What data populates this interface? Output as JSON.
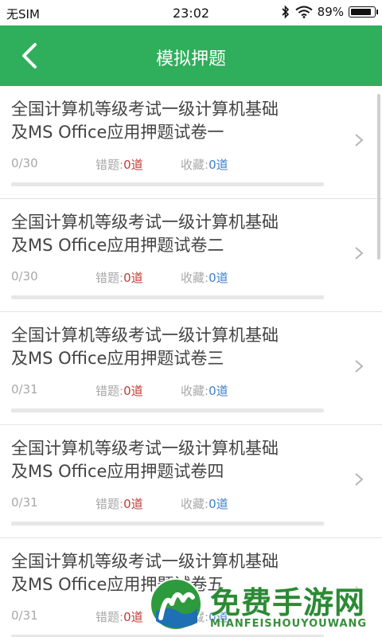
{
  "status_bar": {
    "carrier": "无SIM",
    "time": "23:02",
    "battery": "89%",
    "battery_level": 0.89
  },
  "nav": {
    "title": "模拟押题"
  },
  "labels": {
    "wrong": "错题:",
    "favorite": "收藏:"
  },
  "items": [
    {
      "title_line1": "全国计算机等级考试一级计算机基础",
      "title_line2": "及MS Office应用押题试卷一",
      "progress": "0/30",
      "wrong_count": "0道",
      "fav_count": "0道",
      "completion": 0
    },
    {
      "title_line1": "全国计算机等级考试一级计算机基础",
      "title_line2": "及MS Office应用押题试卷二",
      "progress": "0/30",
      "wrong_count": "0道",
      "fav_count": "0道",
      "completion": 0
    },
    {
      "title_line1": "全国计算机等级考试一级计算机基础",
      "title_line2": "及MS Office应用押题试卷三",
      "progress": "0/31",
      "wrong_count": "0道",
      "fav_count": "0道",
      "completion": 0
    },
    {
      "title_line1": "全国计算机等级考试一级计算机基础",
      "title_line2": "及MS Office应用押题试卷四",
      "progress": "0/31",
      "wrong_count": "0道",
      "fav_count": "0道",
      "completion": 0
    },
    {
      "title_line1": "全国计算机等级考试一级计算机基础",
      "title_line2": "及MS Office应用押题试卷五",
      "progress": "0/31",
      "wrong_count": "0道",
      "fav_count": "0道",
      "completion": 0
    }
  ],
  "watermark": {
    "text": "免费手游网",
    "subtext": "MIANFEISHOUYOUWANG"
  },
  "colors": {
    "accent": "#2fae5c",
    "wrong": "#c23b34",
    "favorite": "#3d7fcf"
  }
}
